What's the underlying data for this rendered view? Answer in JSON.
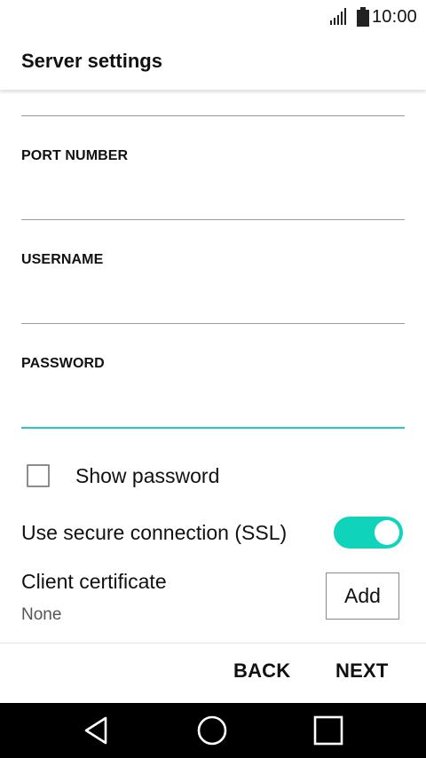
{
  "status_bar": {
    "time": "10:00"
  },
  "header": {
    "title": "Server settings"
  },
  "form": {
    "port": {
      "label": "PORT NUMBER",
      "value": ""
    },
    "username": {
      "label": "USERNAME",
      "value": ""
    },
    "password": {
      "label": "PASSWORD",
      "value": ""
    }
  },
  "show_password": {
    "label": "Show password",
    "checked": false
  },
  "ssl": {
    "label": "Use secure connection (SSL)",
    "enabled": true
  },
  "certificate": {
    "label": "Client certificate",
    "value": "None",
    "add_label": "Add"
  },
  "actions": {
    "back_label": "BACK",
    "next_label": "NEXT"
  },
  "colors": {
    "accent": "#2cc6c9",
    "toggle_on": "#0fd4bb",
    "nav_bar": "#000000"
  },
  "icons": {
    "nav_back": "triangle-back-icon",
    "nav_home": "circle-home-icon",
    "nav_recents": "square-recents-icon"
  }
}
